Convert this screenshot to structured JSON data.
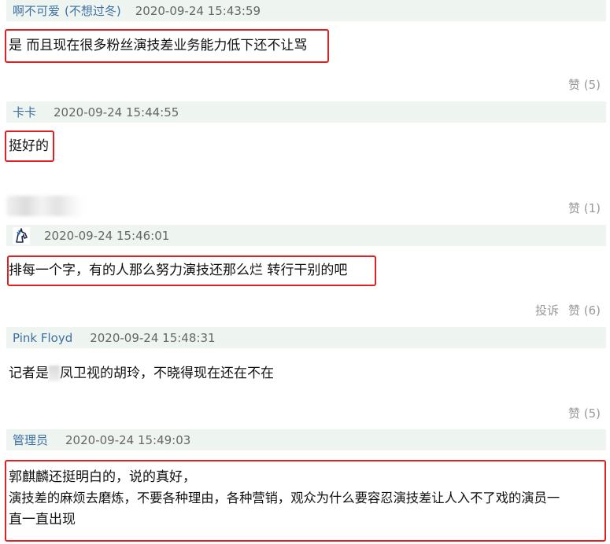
{
  "comments": [
    {
      "author": "啊不可爱",
      "author_note": "(不想过冬)",
      "time": "2020-09-24 15:43:59",
      "text": "是 而且现在很多粉丝演技差业务能力低下还不让骂",
      "like_label": "赞 (5)"
    },
    {
      "author": "卡卡",
      "time": "2020-09-24 15:44:55",
      "text": "挺好的",
      "like_label": "赞 (1)"
    },
    {
      "author_avatar_icon": "unicorn-avatar-icon",
      "time": "2020-09-24 15:46:01",
      "text": "排每一个字，有的人那么努力演技还那么烂 转行干别的吧",
      "report_label": "投诉",
      "like_label": "赞 (6)"
    },
    {
      "author": "Pink Floyd",
      "time": "2020-09-24 15:48:31",
      "text_before": "记者是",
      "text_after": "凤卫视的胡玲，不晓得现在还在不在",
      "like_label": "赞 (5)"
    },
    {
      "author": "管理员",
      "time": "2020-09-24 15:49:03",
      "lines": [
        "郭麒麟还挺明白的，说的真好，",
        "演技差的麻烦去磨炼，不要各种理由，各种营销，观众为什么要容忍演技差让人入不了戏的演员一",
        "直一直出现"
      ]
    }
  ],
  "colors": {
    "header_bg": "#eef4ef",
    "author": "#3d6fa3",
    "highlight_border": "#e02020",
    "muted": "#999999"
  }
}
